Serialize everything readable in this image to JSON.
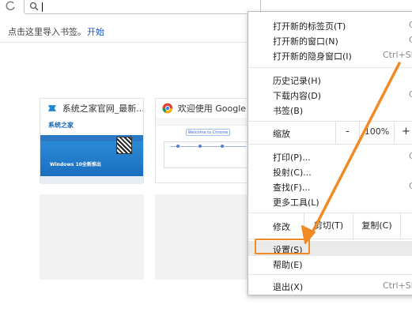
{
  "bookmarks_bar": {
    "prompt": "点击这里导入书签。",
    "link": "开始"
  },
  "tiles": [
    {
      "title": "系统之家官网_最新...",
      "thumb_logo": "系统之家",
      "thumb_text": "Windows 10全新推出"
    },
    {
      "title": "欢迎使用 Google C...",
      "thumb_text": "Welcome to Chrome"
    }
  ],
  "menu": {
    "items_group1": [
      {
        "label": "打开新的标签页(T)",
        "shortcut": "C"
      },
      {
        "label": "打开新的窗口(N)",
        "shortcut": "C"
      },
      {
        "label": "打开新的隐身窗口(I)",
        "shortcut": "Ctrl+Sh"
      }
    ],
    "items_group2": [
      {
        "label": "历史记录(H)",
        "shortcut": ""
      },
      {
        "label": "下载内容(D)",
        "shortcut": "C"
      },
      {
        "label": "书签(B)",
        "shortcut": ""
      }
    ],
    "zoom": {
      "label": "缩放",
      "minus": "-",
      "value": "100%",
      "plus": "+"
    },
    "items_group3": [
      {
        "label": "打印(P)...",
        "shortcut": "C"
      },
      {
        "label": "投射(C)...",
        "shortcut": ""
      },
      {
        "label": "查找(F)...",
        "shortcut": "C"
      },
      {
        "label": "更多工具(L)",
        "shortcut": ""
      }
    ],
    "edit": {
      "label": "修改",
      "cut": "剪切(T)",
      "copy": "复制(C)"
    },
    "settings": "设置(S)",
    "help": "帮助(E)",
    "exit": {
      "label": "退出(X)",
      "shortcut": "Ctrl+Sh"
    }
  },
  "colors": {
    "highlight": "#f08a24",
    "link": "#1a56c4"
  }
}
